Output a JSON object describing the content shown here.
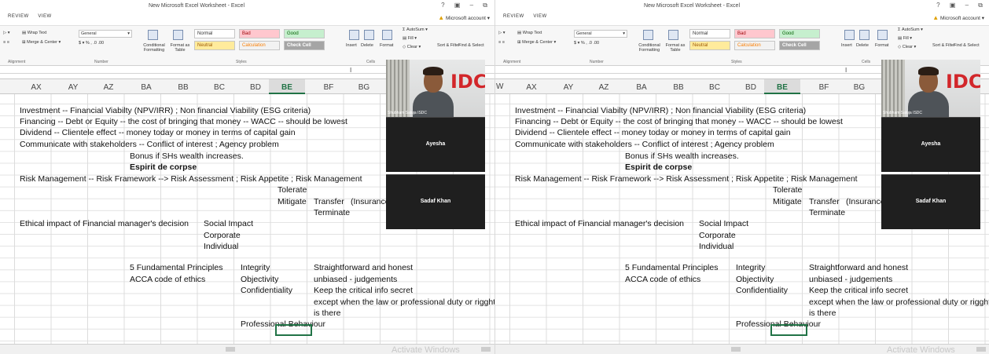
{
  "window": {
    "title": "New Microsoft Excel Worksheet - Excel",
    "menu": [
      "REVIEW",
      "VIEW"
    ],
    "account": "Microsoft account",
    "controls": "? ▣ – ⧉"
  },
  "ribbon": {
    "wrap_text": "Wrap Text",
    "merge_center": "Merge & Center",
    "number_format": "General",
    "conditional_formatting": "Conditional Formatting",
    "format_as_table": "Format as Table",
    "styles": {
      "normal": "Normal",
      "bad": "Bad",
      "good": "Good",
      "neutral": "Neutral",
      "calculation": "Calculation",
      "check_cell": "Check Cell"
    },
    "insert": "Insert",
    "delete": "Delete",
    "format": "Format",
    "autosum": "AutoSum",
    "fill": "Fill",
    "clear": "Clear",
    "sort_filter": "Sort & Filter",
    "find_select": "Find & Select",
    "groups": {
      "alignment": "Alignment",
      "number": "Number",
      "styles": "Styles",
      "cells": "Cells"
    }
  },
  "columns_left": [
    "AX",
    "AY",
    "AZ",
    "BA",
    "BB",
    "BC",
    "BD",
    "BE",
    "BF",
    "BG"
  ],
  "columns_right": [
    "AX",
    "AY",
    "AZ",
    "BA",
    "BB",
    "BC",
    "BD",
    "BE",
    "BF",
    "BG"
  ],
  "active_column": "BE",
  "row_marker": "W",
  "cells": {
    "r1": "Investment -- Financial Viabilty (NPV/IRR) ; Non financial Viability (ESG criteria)",
    "r2": "Financing -- Debt or Equity -- the cost of bringing that money -- WACC -- should be lowest",
    "r3": "Dividend -- Clientele effect -- money today or money in terms of capital gain",
    "r4": "Communicate with stakeholders -- Conflict of interest ; Agency problem",
    "r5": "Bonus if SHs wealth increases.",
    "r6": "Espirit de corpse",
    "r7": "Risk Management -- Risk Framework --> Risk Assessment ; Risk Appetite ; Risk Management",
    "tolerate": "Tolerate",
    "mitigate": "Mitigate",
    "transfer": "Transfer",
    "insurance": "(Insurance",
    "terminate": "Terminate",
    "ethical": "Ethical impact of Financial manager's decision",
    "social": "Social Impact",
    "corporate": "Corporate",
    "individual": "Individual",
    "fundamental": "5 Fundamental Principles",
    "acca": "ACCA code of ethics",
    "integrity": "Integrity",
    "objectivity": "Objectivity",
    "confidentiality": "Confidentiality",
    "straightforward": "Straightforward and honest",
    "unbiased": "unbiased - judgements",
    "keep": "Keep the critical info secret",
    "except": "except when the law or professional duty or rigght",
    "isthere": "is there",
    "professional": "Professional Behaviour"
  },
  "video": {
    "presenter": "Shubham Saluja ISDC",
    "logo": "IDC",
    "participant1": "Ayesha",
    "participant2": "Sadaf Khan"
  },
  "watermark": "Activate Windows"
}
